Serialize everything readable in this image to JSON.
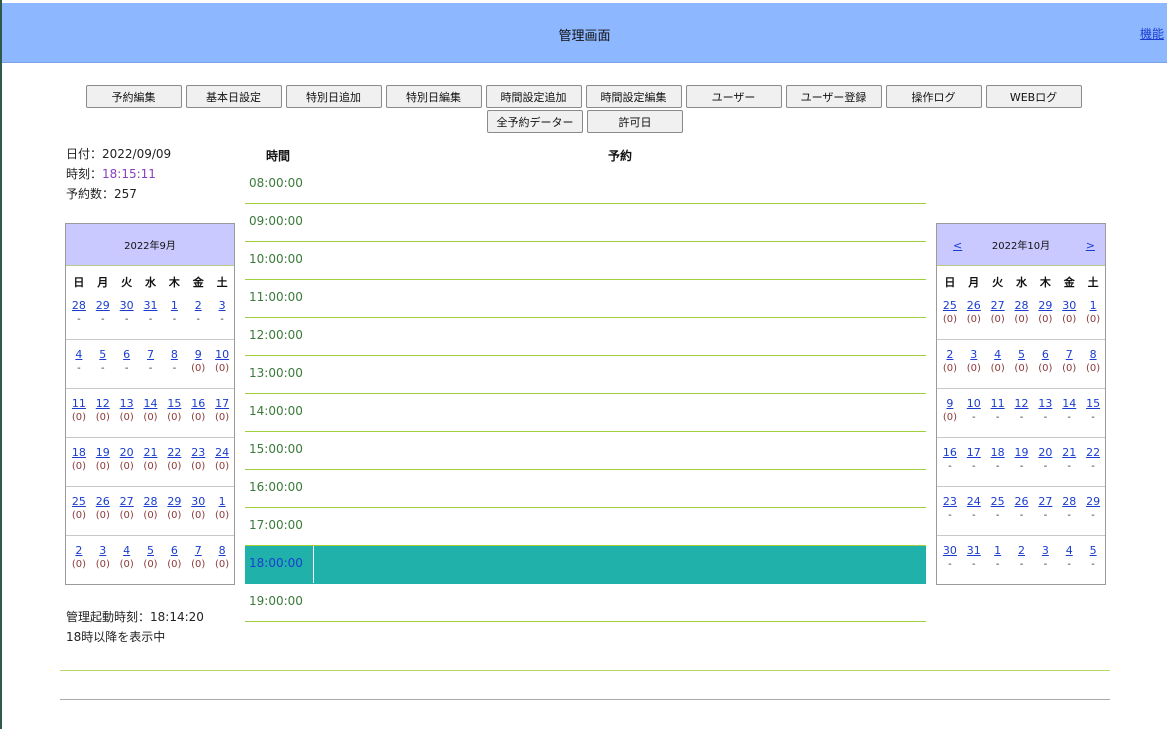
{
  "header": {
    "title": "管理画面",
    "link": "機能"
  },
  "buttons_row1": [
    "予約編集",
    "基本日設定",
    "特別日追加",
    "特別日編集",
    "時間設定追加",
    "時間設定編集",
    "ユーザー",
    "ユーザー登録",
    "操作ログ",
    "WEBログ"
  ],
  "buttons_row2": [
    "全予約データー",
    "許可日"
  ],
  "info": {
    "date_label": "日付：",
    "date": "2022/09/09",
    "time_label": "時刻：",
    "time": "18:15:11",
    "count_label": "予約数：",
    "count": "257"
  },
  "schedule": {
    "time_header": "時間",
    "reservation_header": "予約",
    "slots": [
      "08:00:00",
      "09:00:00",
      "10:00:00",
      "11:00:00",
      "12:00:00",
      "13:00:00",
      "14:00:00",
      "15:00:00",
      "16:00:00",
      "17:00:00",
      "18:00:00",
      "19:00:00"
    ],
    "active_slot": "18:00:00"
  },
  "weekdays": [
    "日",
    "月",
    "火",
    "水",
    "木",
    "金",
    "土"
  ],
  "calendar_left": {
    "title": "2022年9月",
    "weeks": [
      [
        [
          "28",
          "-"
        ],
        [
          "29",
          "-"
        ],
        [
          "30",
          "-"
        ],
        [
          "31",
          "-"
        ],
        [
          "1",
          "-"
        ],
        [
          "2",
          "-"
        ],
        [
          "3",
          "-"
        ]
      ],
      [
        [
          "4",
          "-"
        ],
        [
          "5",
          "-"
        ],
        [
          "6",
          "-"
        ],
        [
          "7",
          "-"
        ],
        [
          "8",
          "-"
        ],
        [
          "9",
          "(0)"
        ],
        [
          "10",
          "(0)"
        ]
      ],
      [
        [
          "11",
          "(0)"
        ],
        [
          "12",
          "(0)"
        ],
        [
          "13",
          "(0)"
        ],
        [
          "14",
          "(0)"
        ],
        [
          "15",
          "(0)"
        ],
        [
          "16",
          "(0)"
        ],
        [
          "17",
          "(0)"
        ]
      ],
      [
        [
          "18",
          "(0)"
        ],
        [
          "19",
          "(0)"
        ],
        [
          "20",
          "(0)"
        ],
        [
          "21",
          "(0)"
        ],
        [
          "22",
          "(0)"
        ],
        [
          "23",
          "(0)"
        ],
        [
          "24",
          "(0)"
        ]
      ],
      [
        [
          "25",
          "(0)"
        ],
        [
          "26",
          "(0)"
        ],
        [
          "27",
          "(0)"
        ],
        [
          "28",
          "(0)"
        ],
        [
          "29",
          "(0)"
        ],
        [
          "30",
          "(0)"
        ],
        [
          "1",
          "(0)"
        ]
      ],
      [
        [
          "2",
          "(0)"
        ],
        [
          "3",
          "(0)"
        ],
        [
          "4",
          "(0)"
        ],
        [
          "5",
          "(0)"
        ],
        [
          "6",
          "(0)"
        ],
        [
          "7",
          "(0)"
        ],
        [
          "8",
          "(0)"
        ]
      ]
    ]
  },
  "calendar_right": {
    "title": "2022年10月",
    "prev": "<",
    "next": ">",
    "weeks": [
      [
        [
          "25",
          "(0)"
        ],
        [
          "26",
          "(0)"
        ],
        [
          "27",
          "(0)"
        ],
        [
          "28",
          "(0)"
        ],
        [
          "29",
          "(0)"
        ],
        [
          "30",
          "(0)"
        ],
        [
          "1",
          "(0)"
        ]
      ],
      [
        [
          "2",
          "(0)"
        ],
        [
          "3",
          "(0)"
        ],
        [
          "4",
          "(0)"
        ],
        [
          "5",
          "(0)"
        ],
        [
          "6",
          "(0)"
        ],
        [
          "7",
          "(0)"
        ],
        [
          "8",
          "(0)"
        ]
      ],
      [
        [
          "9",
          "(0)"
        ],
        [
          "10",
          "-"
        ],
        [
          "11",
          "-"
        ],
        [
          "12",
          "-"
        ],
        [
          "13",
          "-"
        ],
        [
          "14",
          "-"
        ],
        [
          "15",
          "-"
        ]
      ],
      [
        [
          "16",
          "-"
        ],
        [
          "17",
          "-"
        ],
        [
          "18",
          "-"
        ],
        [
          "19",
          "-"
        ],
        [
          "20",
          "-"
        ],
        [
          "21",
          "-"
        ],
        [
          "22",
          "-"
        ]
      ],
      [
        [
          "23",
          "-"
        ],
        [
          "24",
          "-"
        ],
        [
          "25",
          "-"
        ],
        [
          "26",
          "-"
        ],
        [
          "27",
          "-"
        ],
        [
          "28",
          "-"
        ],
        [
          "29",
          "-"
        ]
      ],
      [
        [
          "30",
          "-"
        ],
        [
          "31",
          "-"
        ],
        [
          "1",
          "-"
        ],
        [
          "2",
          "-"
        ],
        [
          "3",
          "-"
        ],
        [
          "4",
          "-"
        ],
        [
          "5",
          "-"
        ]
      ]
    ]
  },
  "footer": {
    "startup_label": "管理起動時刻：",
    "startup_time": "18:14:20",
    "note": "18時以降を表示中"
  },
  "colors": {
    "header": "#8db7ff",
    "calendar_head": "#c9c9ff",
    "active_slot": "#20b2aa",
    "slot_line": "#9fcf3a"
  }
}
